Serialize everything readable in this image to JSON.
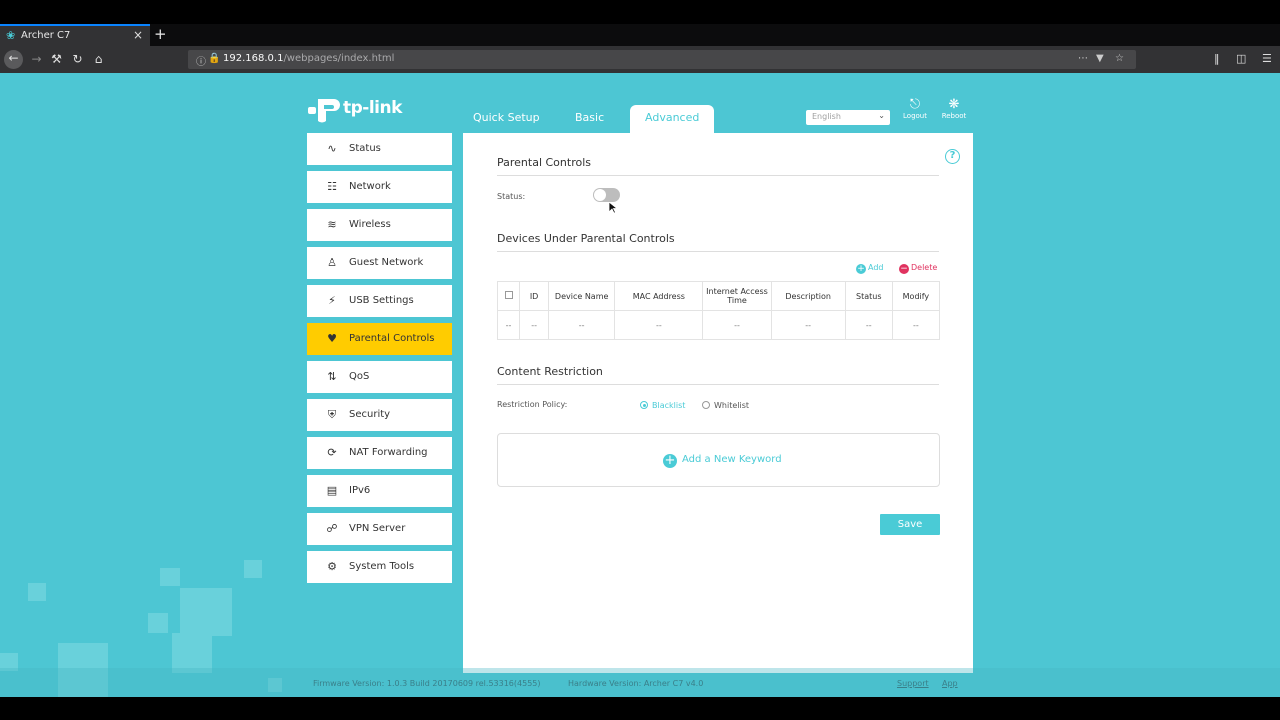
{
  "browser": {
    "tab_title": "Archer C7",
    "url_host": "192.168.0.1",
    "url_path": "/webpages/index.html"
  },
  "header": {
    "logo_text": "tp-link",
    "tabs": [
      {
        "label": "Quick Setup"
      },
      {
        "label": "Basic"
      },
      {
        "label": "Advanced"
      }
    ],
    "language": "English",
    "logout_label": "Logout",
    "reboot_label": "Reboot"
  },
  "sidebar": {
    "items": [
      {
        "label": "Status",
        "icon": "pulse-icon"
      },
      {
        "label": "Network",
        "icon": "network-icon"
      },
      {
        "label": "Wireless",
        "icon": "wifi-icon"
      },
      {
        "label": "Guest Network",
        "icon": "guests-icon"
      },
      {
        "label": "USB Settings",
        "icon": "usb-icon"
      },
      {
        "label": "Parental Controls",
        "icon": "heart-icon"
      },
      {
        "label": "QoS",
        "icon": "arrows-updown-icon"
      },
      {
        "label": "Security",
        "icon": "shield-icon"
      },
      {
        "label": "NAT Forwarding",
        "icon": "nat-icon"
      },
      {
        "label": "IPv6",
        "icon": "ipv6-icon"
      },
      {
        "label": "VPN Server",
        "icon": "vpn-icon"
      },
      {
        "label": "System Tools",
        "icon": "gear-icon"
      }
    ],
    "active": "Parental Controls"
  },
  "main": {
    "section1_title": "Parental Controls",
    "status_label": "Status:",
    "status_on": false,
    "section2_title": "Devices Under Parental Controls",
    "add_label": "Add",
    "delete_label": "Delete",
    "table": {
      "headers": [
        "",
        "ID",
        "Device Name",
        "MAC Address",
        "Internet Access Time",
        "Description",
        "Status",
        "Modify"
      ],
      "rows": [
        [
          "--",
          "--",
          "--",
          "--",
          "--",
          "--",
          "--",
          "--"
        ]
      ]
    },
    "section3_title": "Content Restriction",
    "restriction_label": "Restriction Policy:",
    "blacklist_label": "Blacklist",
    "whitelist_label": "Whitelist",
    "selected_policy": "Blacklist",
    "add_keyword_label": "Add a New Keyword",
    "save_label": "Save"
  },
  "footer": {
    "firmware": "Firmware Version: 1.0.3 Build 20170609 rel.53316(4555)",
    "hardware": "Hardware Version: Archer C7 v4.0",
    "support": "Support",
    "app": "App"
  },
  "colors": {
    "accent": "#4acbd6",
    "page_bg": "#4dc6d3",
    "active_item": "#ffcc00",
    "delete": "#e0325f"
  }
}
